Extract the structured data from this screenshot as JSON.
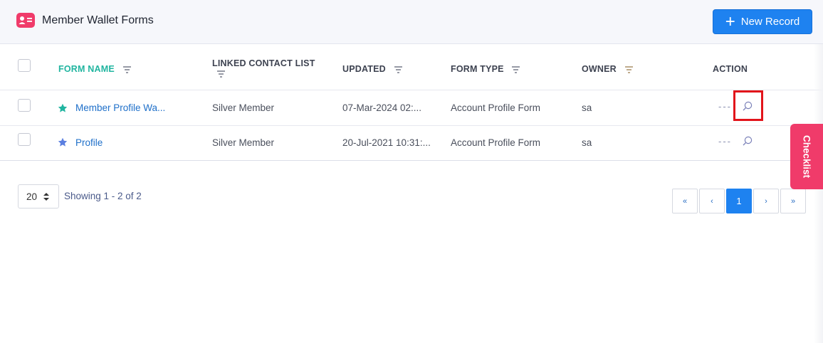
{
  "header": {
    "title": "Member Wallet Forms",
    "app_icon": "contact-card-icon",
    "new_record_label": "New Record"
  },
  "table": {
    "columns": [
      {
        "label": "FORM NAME",
        "sortable_filter": true,
        "active": true
      },
      {
        "label": "LINKED CONTACT LIST",
        "sortable_filter": true
      },
      {
        "label": "UPDATED",
        "sortable_filter": true
      },
      {
        "label": "FORM TYPE",
        "sortable_filter": true
      },
      {
        "label": "OWNER",
        "sortable_filter": true
      },
      {
        "label": "ACTION",
        "sortable_filter": false
      }
    ],
    "rows": [
      {
        "form_name": "Member Profile Wa...",
        "star_color": "#21b5a0",
        "linked_contact_list": "Silver Member",
        "updated": "07-Mar-2024 02:...",
        "form_type": "Account Profile Form",
        "owner": "sa",
        "action_more": "---"
      },
      {
        "form_name": "Profile",
        "star_color": "#5b7fe0",
        "linked_contact_list": "Silver Member",
        "updated": "20-Jul-2021 10:31:...",
        "form_type": "Account Profile Form",
        "owner": "sa",
        "action_more": "---"
      }
    ]
  },
  "pagination": {
    "page_size": "20",
    "showing": "Showing 1 - 2 of 2",
    "first": "«",
    "prev": "‹",
    "current": "1",
    "next": "›",
    "last": "»"
  },
  "side_tab": {
    "label": "Checklist"
  },
  "colors": {
    "accent": "#1e82f0",
    "brand_pink": "#f03b6a",
    "teal": "#21b5a0",
    "highlight_red": "#e2141b"
  }
}
